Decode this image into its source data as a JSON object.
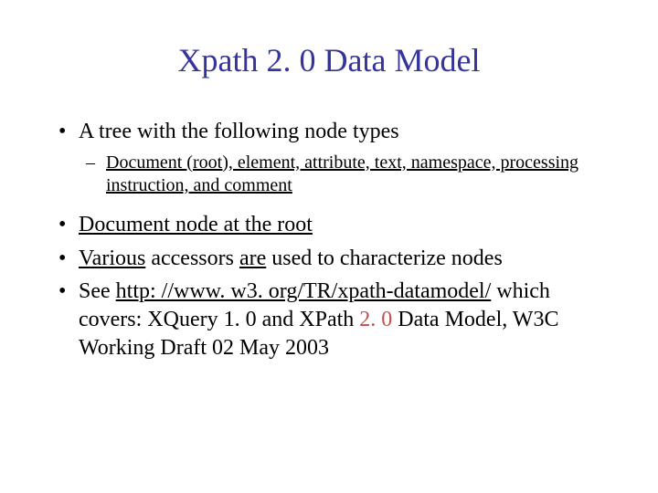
{
  "title": "Xpath 2. 0 Data Model",
  "bullets": {
    "b1": "A tree with the following node types",
    "b1_sub": "Document (root), element, attribute, text, namespace, processing instruction, and comment",
    "b2_u1": "Document node at the root",
    "b3_u1": "Various",
    "b3_p1": " accessors ",
    "b3_u2": "are",
    "b3_p2": " used to characterize nodes",
    "b4_p1": "See ",
    "b4_link": "http: //www. w3. org/TR/xpath-datamodel/",
    "b4_p2": " which covers: XQuery 1. 0 and XPath ",
    "b4_red": "2. 0 ",
    "b4_p3": "Data Model, W3C Working Draft 02 May 2003"
  }
}
